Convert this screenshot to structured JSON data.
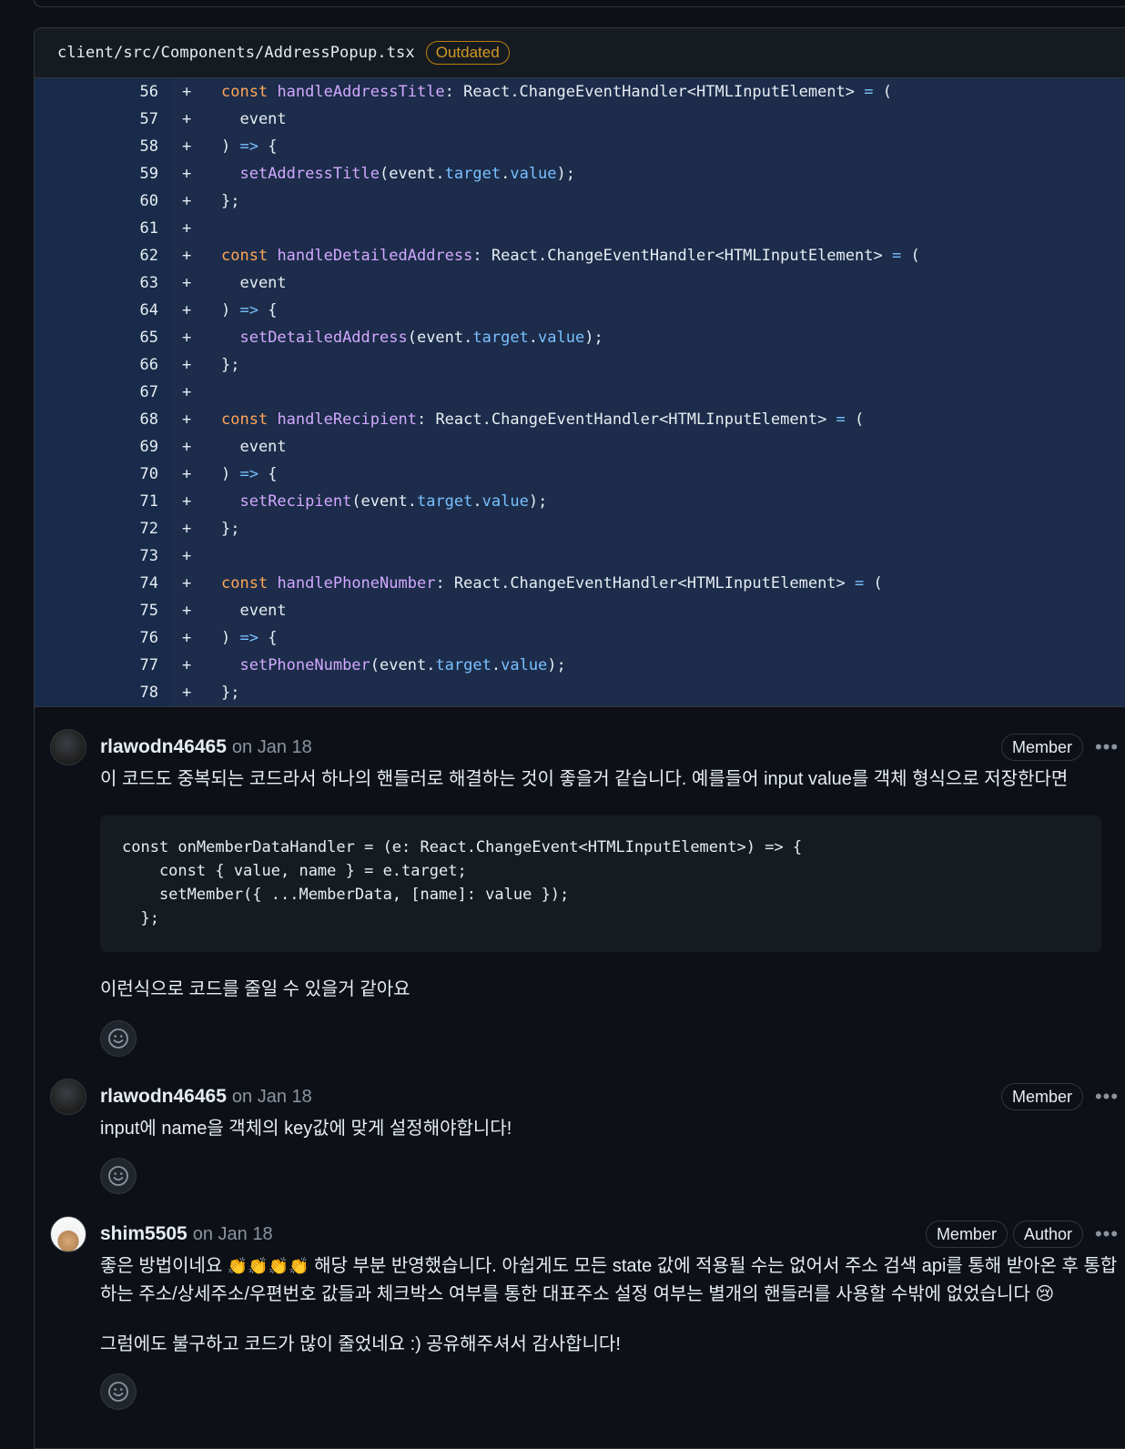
{
  "file": {
    "path": "client/src/Components/AddressPopup.tsx",
    "status_badge": "Outdated"
  },
  "diff": {
    "marker": "+",
    "lines": [
      {
        "num": "56",
        "html": "<span class='t-kwc'>const</span> <span class='t-fn'>handleAddressTitle</span>: React.ChangeEventHandler&lt;HTMLInputElement&gt; <span class='t-op'>=</span> ("
      },
      {
        "num": "57",
        "html": "  event"
      },
      {
        "num": "58",
        "html": ") <span class='t-op'>=&gt;</span> {"
      },
      {
        "num": "59",
        "html": "  <span class='t-fn'>setAddressTitle</span>(event.<span class='t-prop'>target</span>.<span class='t-prop'>value</span>);"
      },
      {
        "num": "60",
        "html": "};"
      },
      {
        "num": "61",
        "html": ""
      },
      {
        "num": "62",
        "html": "<span class='t-kwc'>const</span> <span class='t-fn'>handleDetailedAddress</span>: React.ChangeEventHandler&lt;HTMLInputElement&gt; <span class='t-op'>=</span> ("
      },
      {
        "num": "63",
        "html": "  event"
      },
      {
        "num": "64",
        "html": ") <span class='t-op'>=&gt;</span> {"
      },
      {
        "num": "65",
        "html": "  <span class='t-fn'>setDetailedAddress</span>(event.<span class='t-prop'>target</span>.<span class='t-prop'>value</span>);"
      },
      {
        "num": "66",
        "html": "};"
      },
      {
        "num": "67",
        "html": ""
      },
      {
        "num": "68",
        "html": "<span class='t-kwc'>const</span> <span class='t-fn'>handleRecipient</span>: React.ChangeEventHandler&lt;HTMLInputElement&gt; <span class='t-op'>=</span> ("
      },
      {
        "num": "69",
        "html": "  event"
      },
      {
        "num": "70",
        "html": ") <span class='t-op'>=&gt;</span> {"
      },
      {
        "num": "71",
        "html": "  <span class='t-fn'>setRecipient</span>(event.<span class='t-prop'>target</span>.<span class='t-prop'>value</span>);"
      },
      {
        "num": "72",
        "html": "};"
      },
      {
        "num": "73",
        "html": ""
      },
      {
        "num": "74",
        "html": "<span class='t-kwc'>const</span> <span class='t-fn'>handlePhoneNumber</span>: React.ChangeEventHandler&lt;HTMLInputElement&gt; <span class='t-op'>=</span> ("
      },
      {
        "num": "75",
        "html": "  event"
      },
      {
        "num": "76",
        "html": ") <span class='t-op'>=&gt;</span> {"
      },
      {
        "num": "77",
        "html": "  <span class='t-fn'>setPhoneNumber</span>(event.<span class='t-prop'>target</span>.<span class='t-prop'>value</span>);"
      },
      {
        "num": "78",
        "html": "};"
      }
    ]
  },
  "comments": [
    {
      "author": "rlawodn46465",
      "date": "on Jan 18",
      "badges": [
        "Member"
      ],
      "body1": "이 코드도 중복되는 코드라서 하나의 핸들러로 해결하는 것이 좋을거 같습니다. 예를들어 input value를 객체 형식으로 저장한다면",
      "code": "const onMemberDataHandler = (e: React.ChangeEvent<HTMLInputElement>) => {\n    const { value, name } = e.target;\n    setMember({ ...MemberData, [name]: value });\n  };",
      "body2": "이런식으로 코드를 줄일 수 있을거 같아요"
    },
    {
      "author": "rlawodn46465",
      "date": "on Jan 18",
      "badges": [
        "Member"
      ],
      "body1": "input에 name을 객체의 key값에 맞게 설정해야합니다!"
    },
    {
      "author": "shim5505",
      "date": "on Jan 18",
      "badges": [
        "Member",
        "Author"
      ],
      "body1a": "좋은 방법이네요",
      "emoji_clap": "👏👏👏👏",
      "body1b": "해당 부분 반영했습니다. 아쉽게도 모든 state 값에 적용될 수는 없어서 주소 검색 api를 통해 받아온 후 통합하는 주소/상세주소/우편번호 값들과 체크박스 여부를 통한 대표주소 설정 여부는 별개의 핸들러를 사용할 수밖에 없었습니다",
      "emoji_sad": "😢",
      "body2": "그럼에도 불구하고 코드가 많이 줄었네요 :) 공유해주셔서 감사합니다!"
    }
  ],
  "kebab_label": "•••",
  "icons": {
    "reaction": "smiley-icon",
    "more": "kebab-horizontal-icon"
  }
}
